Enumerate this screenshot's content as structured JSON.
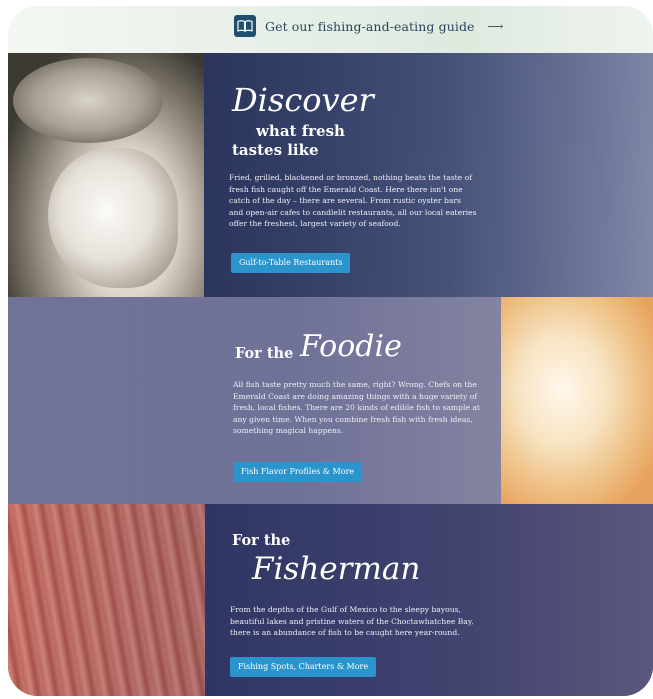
{
  "guide_bar": {
    "text": "Get our fishing-and-eating guide",
    "arrow": "⟶",
    "icon": "book-icon"
  },
  "discover": {
    "title_script": "Discover",
    "title_line2": "what fresh",
    "title_line3": "tastes like",
    "body": "Fried, grilled, blackened or bronzed, nothing beats the taste of fresh fish caught off the Emerald Coast. Here there isn't one catch of the day – there are several. From rustic oyster bars and open-air cafes to candlelit restaurants, all our local eateries offer the freshest, largest variety of seafood.",
    "button": "Gulf-to-Table Restaurants"
  },
  "foodie": {
    "title_prefix": "For the",
    "title_script": "Foodie",
    "body": "All fish taste pretty much the same, right? Wrong. Chefs on the Emerald Coast are doing amazing things with a huge variety of fresh, local fishes. There are 20 kinds of edible fish to sample at any given time. When you combine fresh fish with fresh ideas, something magical happens.",
    "button": "Fish Flavor Profiles & More"
  },
  "fisherman": {
    "title_prefix": "For the",
    "title_script": "Fisherman",
    "body": "From the depths of the Gulf of Mexico to the sleepy bayous, beautiful lakes and pristine waters of the Choctawhatchee Bay, there is an abundance of fish to be caught here year-round.",
    "button": "Fishing Spots, Charters & More"
  },
  "colors": {
    "button_blue": "#2a94cd",
    "guide_navy": "#1f4f6e"
  }
}
